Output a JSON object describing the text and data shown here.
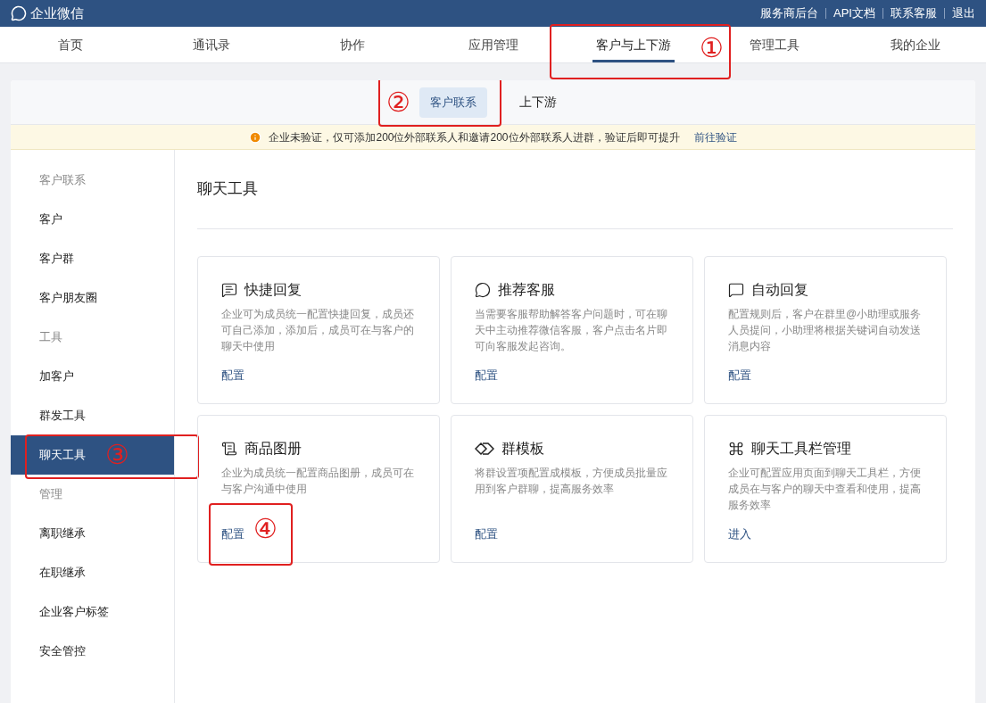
{
  "top_bar": {
    "logo_text": "企业微信",
    "links": [
      "服务商后台",
      "API文档",
      "联系客服",
      "退出"
    ]
  },
  "nav": {
    "tabs": [
      {
        "label": "首页",
        "selected": false
      },
      {
        "label": "通讯录",
        "selected": false
      },
      {
        "label": "协作",
        "selected": false
      },
      {
        "label": "应用管理",
        "selected": false
      },
      {
        "label": "客户与上下游",
        "selected": true,
        "annotation": "①"
      },
      {
        "label": "管理工具",
        "selected": false
      },
      {
        "label": "我的企业",
        "selected": false
      }
    ]
  },
  "sub_tabs": [
    {
      "label": "客户联系",
      "selected": true,
      "annotation": "②"
    },
    {
      "label": "上下游",
      "selected": false
    }
  ],
  "notice": {
    "text": "企业未验证，仅可添加200位外部联系人和邀请200位外部联系人进群，验证后即可提升",
    "link": "前往验证"
  },
  "sidebar": {
    "sections": [
      {
        "title": "客户联系",
        "items": [
          {
            "label": "客户",
            "selected": false
          },
          {
            "label": "客户群",
            "selected": false
          },
          {
            "label": "客户朋友圈",
            "selected": false
          }
        ]
      },
      {
        "title": "工具",
        "items": [
          {
            "label": "加客户",
            "selected": false
          },
          {
            "label": "群发工具",
            "selected": false
          },
          {
            "label": "聊天工具",
            "selected": true,
            "annotation": "③"
          }
        ]
      },
      {
        "title": "管理",
        "items": [
          {
            "label": "离职继承",
            "selected": false
          },
          {
            "label": "在职继承",
            "selected": false
          },
          {
            "label": "企业客户标签",
            "selected": false
          },
          {
            "label": "安全管控",
            "selected": false
          }
        ]
      }
    ]
  },
  "page_title": "聊天工具",
  "cards": [
    {
      "kind": "quick_reply",
      "title": "快捷回复",
      "description": "企业可为成员统一配置快捷回复，成员还可自己添加，添加后，成员可在与客户的聊天中使用",
      "action": "配置"
    },
    {
      "kind": "recommend",
      "title": "推荐客服",
      "description": "当需要客服帮助解答客户问题时，可在聊天中主动推荐微信客服，客户点击名片即可向客服发起咨询。",
      "action": "配置"
    },
    {
      "kind": "auto_reply",
      "title": "自动回复",
      "description": "配置规则后，客户在群里@小助理或服务人员提问，小助理将根据关键词自动发送消息内容",
      "action": "配置"
    },
    {
      "kind": "catalog",
      "title": "商品图册",
      "description": "企业为成员统一配置商品图册，成员可在与客户沟通中使用",
      "action": "配置",
      "annotation": "④"
    },
    {
      "kind": "template",
      "title": "群模板",
      "description": "将群设置项配置成模板，方便成员批量应用到客户群聊，提高服务效率",
      "action": "配置"
    },
    {
      "kind": "toolbar",
      "title": "聊天工具栏管理",
      "description": "企业可配置应用页面到聊天工具栏，方便成员在与客户的聊天中查看和使用，提高服务效率",
      "action": "进入"
    }
  ]
}
